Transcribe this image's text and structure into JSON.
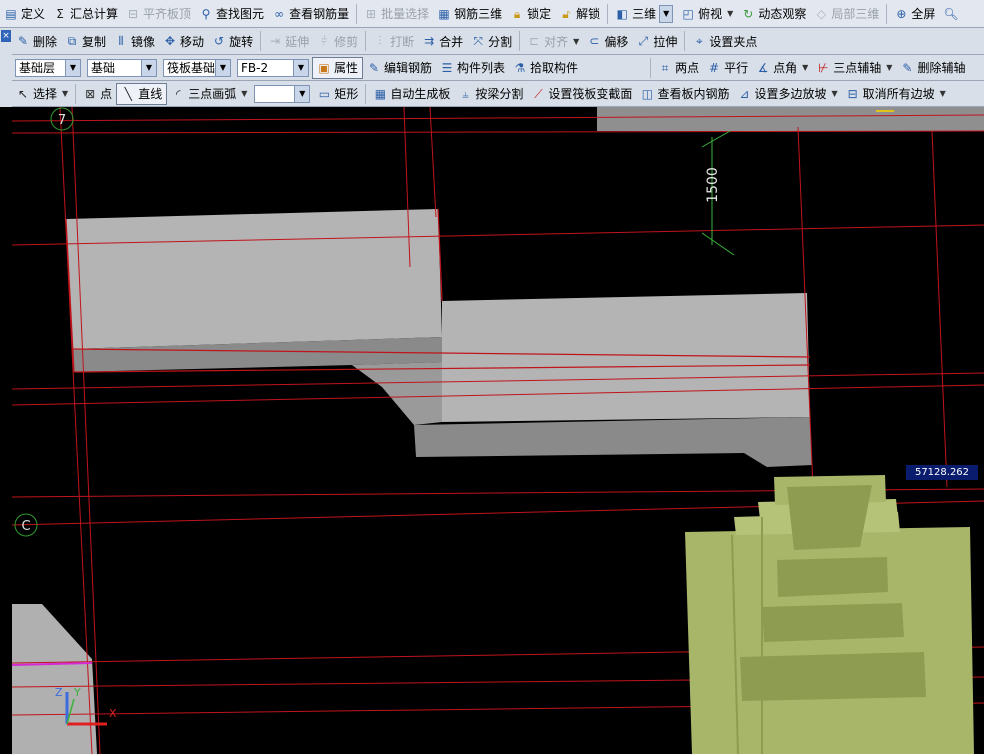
{
  "toolbar1": {
    "define": "定义",
    "sum_calc": "汇总计算",
    "flat_top": "平齐板顶",
    "find_element": "查找图元",
    "view_rebar": "查看钢筋量",
    "batch_select": "批量选择",
    "rebar_3d": "钢筋三维",
    "lock": "锁定",
    "unlock": "解锁",
    "view_3d": "三维",
    "top_view": "俯视",
    "dynamic_view": "动态观察",
    "local_3d": "局部三维",
    "fullscreen": "全屏"
  },
  "toolbar2": {
    "delete": "删除",
    "copy": "复制",
    "mirror": "镜像",
    "move": "移动",
    "rotate": "旋转",
    "extend": "延伸",
    "trim": "修剪",
    "break": "打断",
    "merge": "合并",
    "split": "分割",
    "align": "对齐",
    "offset": "偏移",
    "stretch": "拉伸",
    "set_grip": "设置夹点"
  },
  "toolbar3": {
    "layer": "基础层",
    "category": "基础",
    "component_type": "筏板基础",
    "component": "FB-2",
    "properties": "属性",
    "edit_rebar": "编辑钢筋",
    "component_list": "构件列表",
    "pick_component": "拾取构件",
    "two_points": "两点",
    "parallel": "平行",
    "point_angle": "点角",
    "three_point_axis": "三点辅轴",
    "delete_axis": "删除辅轴"
  },
  "toolbar4": {
    "select": "选择",
    "point": "点",
    "line": "直线",
    "three_point_arc": "三点画弧",
    "arc_value": "",
    "rectangle": "矩形",
    "auto_generate_slab": "自动生成板",
    "split_by_beam": "按梁分割",
    "set_raft_section": "设置筏板变截面",
    "view_slab_rebar": "查看板内钢筋",
    "set_multi_slope": "设置多边放坡",
    "cancel_all_slope": "取消所有边坡"
  },
  "canvas": {
    "axis_label_7": "7",
    "axis_label_c": "C",
    "dimension_text": "1500",
    "coordinate_readout": "57128.262",
    "axis_x": "X",
    "axis_y": "Y",
    "axis_z": "Z"
  },
  "colors": {
    "background": "#000000",
    "grid_line": "#c0141b",
    "slab_top": "#b4b4b4",
    "slab_front": "#8a8a8a",
    "foundation": "#a8b66a",
    "dimension": "#3bb33b"
  }
}
